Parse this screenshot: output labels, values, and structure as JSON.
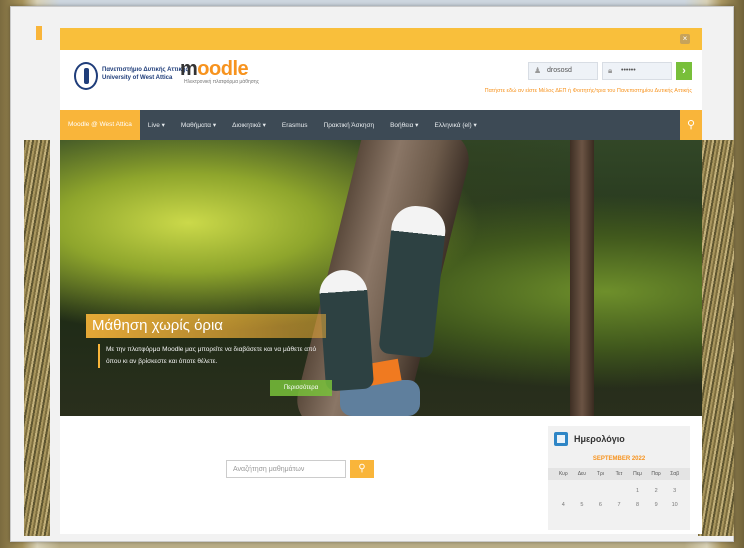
{
  "university": {
    "name_line1": "Πανεπιστήμιο Δυτικής Αττικής",
    "name_line2": "University of West Attica"
  },
  "moodle": {
    "logo_prefix": "m",
    "logo_rest": "oodle",
    "tagline": "Ηλεκτρονική πλατφόρμα μάθησης"
  },
  "login": {
    "username": "drososd",
    "password_mask": "••••••",
    "submit_glyph": "›",
    "help_text": "Πατήστε εδώ αν είστε Μέλος ΔΕΠ ή Φοιτητής/τρια του Πανεπιστημίου Δυτικής Αττικής"
  },
  "nav": {
    "brand": "Moodle @ West Attica",
    "items": [
      "Live ▾",
      "Μαθήματα ▾",
      "Διοικητικά ▾",
      "Erasmus",
      "Πρακτική Άσκηση",
      "Βοήθεια ▾",
      "Ελληνικά (el) ▾"
    ],
    "search_glyph": "⚲"
  },
  "hero": {
    "title": "Μάθηση χωρίς όρια",
    "text": "Με την πλατφόρμα Moodle μας μπορείτε να διαβάσετε και να μάθετε από όπου κι αν βρίσκεστε και όποτε θέλετε.",
    "button": "Περισσότερα"
  },
  "course_search": {
    "placeholder": "Αναζήτηση μαθημάτων",
    "button_glyph": "⚲"
  },
  "calendar": {
    "title": "Ημερολόγιο",
    "month": "SEPTEMBER 2022",
    "weekdays": [
      "Κυρ",
      "Δευ",
      "Τρι",
      "Τετ",
      "Πεμ",
      "Παρ",
      "Σαβ"
    ],
    "rows": [
      [
        "",
        "",
        "",
        "",
        "1",
        "2",
        "3"
      ],
      [
        "4",
        "5",
        "6",
        "7",
        "8",
        "9",
        "10"
      ]
    ]
  },
  "notice": {
    "close_glyph": "×"
  }
}
